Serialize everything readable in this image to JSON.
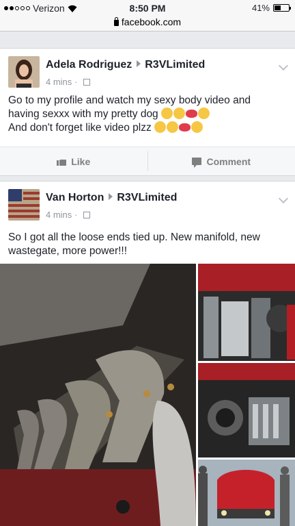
{
  "status_bar": {
    "carrier": "Verizon",
    "time": "8:50 PM",
    "battery": "41%"
  },
  "url_bar": {
    "domain": "facebook.com"
  },
  "posts": [
    {
      "author": "Adela Rodriguez",
      "group": "R3VLimited",
      "time": "4 mins",
      "text_lines": [
        "Go to my profile and watch my sexy body video and",
        "having sexxx with my pretty dog",
        "And don't forget like video plzz"
      ],
      "actions": {
        "like": "Like",
        "comment": "Comment"
      }
    },
    {
      "author": "Van Horton",
      "group": "R3VLimited",
      "time": "4 mins",
      "text_lines": [
        "So I got all the loose ends tied up. New manifold, new",
        "wastegate, more power!!!"
      ]
    }
  ],
  "colors": {
    "accent_link": "#1d2129",
    "meta_gray": "#90949c",
    "page_bg": "#e9eaed"
  }
}
